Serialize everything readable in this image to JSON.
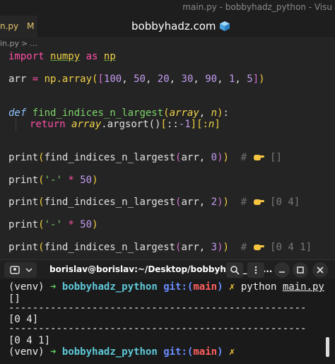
{
  "window": {
    "title": "main.py - bobbyhadz_python - Visu"
  },
  "tab": {
    "label": "n.py",
    "modified": "M"
  },
  "watermark": {
    "text": "bobbyhadz.com"
  },
  "breadcrumb": {
    "file": "in.py",
    "sep": ">",
    "rest": "..."
  },
  "editor": {
    "import": {
      "kw": "import",
      "module": "numpy",
      "as": "as",
      "alias": "np"
    },
    "arr": {
      "name": "arr",
      "eq": "=",
      "call": "np.array",
      "values": [
        "100",
        "50",
        "20",
        "30",
        "90",
        "1",
        "5"
      ]
    },
    "def": {
      "kw": "def",
      "name": "find_indices_n_largest",
      "param1": "array",
      "param2": "n"
    },
    "ret": {
      "kw": "return",
      "obj": "array",
      "method": ".argsort()",
      "slice1": "::",
      "neg": "-1",
      "slice2_open": "[:",
      "n": "n"
    },
    "calls": [
      {
        "fn": "print",
        "inner": "find_indices_n_largest",
        "arg1": "arr",
        "arg2": "0",
        "result": "[]"
      },
      {
        "fn": "print",
        "str": "'-'",
        "op": "*",
        "num": "50"
      },
      {
        "fn": "print",
        "inner": "find_indices_n_largest",
        "arg1": "arr",
        "arg2": "2",
        "result": "[0 4]"
      },
      {
        "fn": "print",
        "str": "'-'",
        "op": "*",
        "num": "50"
      },
      {
        "fn": "print",
        "inner": "find_indices_n_largest",
        "arg1": "arr",
        "arg2": "3",
        "result": "[0 4 1]"
      }
    ],
    "comment_hash": "#"
  },
  "terminal_header": {
    "title": "borislav@borislav:~/Desktop/bobbyhadz_pyt..."
  },
  "terminal": {
    "venv": "(venv)",
    "arrow": "➜",
    "dir": "bobbyhadz_python",
    "git": "git:",
    "branch_open": "(",
    "branch": "main",
    "branch_close": ")",
    "dirty": "✗",
    "cmd": "python",
    "file": "main.py",
    "out1": "[]",
    "divider": "--------------------------------------------------",
    "out2": "[0 4]",
    "out3": "[0 4 1]"
  },
  "colors": {
    "accent_pink": "#ff4fa8",
    "green": "#5fd05f",
    "cyan": "#5ec8d8",
    "blue": "#6a8cff",
    "red": "#ff5f5f",
    "yellow": "#f0c53a"
  }
}
